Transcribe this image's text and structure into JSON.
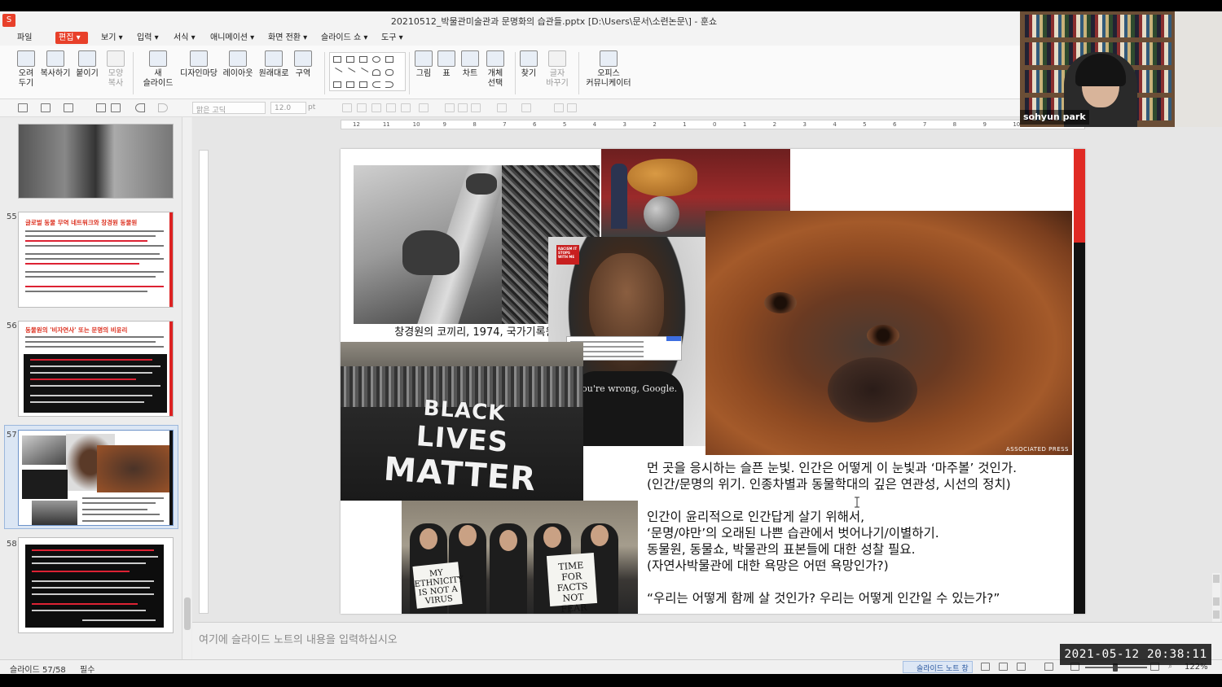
{
  "window": {
    "title": "20210512_박물관미술관과 문명화의 습관들.pptx [D:\\Users\\문서\\소련논문\\] - 훈쇼",
    "app_icon": "hanshow-app-icon"
  },
  "menu": {
    "items": [
      "파일",
      "편집",
      "보기",
      "입력",
      "서식",
      "애니메이션",
      "화면 전환",
      "슬라이드 쇼",
      "도구"
    ],
    "active_index": 1
  },
  "ribbon": {
    "buttons": [
      {
        "label": "오려\n두기",
        "icon": "scissors-icon"
      },
      {
        "label": "복사하기",
        "icon": "copy-icon"
      },
      {
        "label": "붙이기",
        "icon": "paste-icon"
      },
      {
        "label": "모양\n복사",
        "icon": "format-painter-icon",
        "disabled": true
      },
      {
        "label": "새\n슬라이드",
        "icon": "new-slide-icon"
      },
      {
        "label": "디자인마당",
        "icon": "design-icon"
      },
      {
        "label": "레이아웃",
        "icon": "layout-icon"
      },
      {
        "label": "원래대로",
        "icon": "reset-icon"
      },
      {
        "label": "구역",
        "icon": "section-icon"
      },
      {
        "label": "그림",
        "icon": "picture-icon"
      },
      {
        "label": "표",
        "icon": "table-icon"
      },
      {
        "label": "차트",
        "icon": "chart-icon"
      },
      {
        "label": "개체\n선택",
        "icon": "select-object-icon"
      },
      {
        "label": "찾기",
        "icon": "find-icon"
      },
      {
        "label": "글자\n바꾸기",
        "icon": "replace-icon",
        "disabled": true
      },
      {
        "label": "오피스\n커뮤니케이터",
        "icon": "office-communicator-icon"
      }
    ]
  },
  "format_toolbar": {
    "font_name": "맑은 고딕",
    "font_size": "12.0",
    "font_unit": "pt"
  },
  "ruler": {
    "h_ticks": [
      "12",
      "11",
      "10",
      "9",
      "8",
      "7",
      "6",
      "5",
      "4",
      "3",
      "2",
      "1",
      "0",
      "1",
      "2",
      "3",
      "4",
      "5",
      "6",
      "7",
      "8",
      "9",
      "10",
      "11",
      "12"
    ]
  },
  "thumbnails": [
    {
      "number": "",
      "title": ""
    },
    {
      "number": "55",
      "title": "글로벌 동물 무역 네트워크와 창경원 동물원"
    },
    {
      "number": "56",
      "title": "동물원의 '비자연사' 또는 문명의 비윤리"
    },
    {
      "number": "57",
      "title": ""
    },
    {
      "number": "58",
      "title": ""
    }
  ],
  "slide": {
    "elephant_caption": "창경원의 코끼리, 1974, 국가기록원.",
    "ad_logo": "RACISM IT STOPS WITH ME",
    "ad_slogan": "You're wrong, Google.",
    "ap_credit": "ASSOCIATED PRESS",
    "blm_lines": [
      "BLACK",
      "LIVES",
      "MATTER"
    ],
    "sign_left": "MY ETHNICITY IS NOT A VIRUS",
    "sign_right": "TIME FOR FACTS NOT FEAR",
    "text_lines": [
      "먼 곳을 응시하는 슬픈 눈빛. 인간은 어떻게 이 눈빛과 ‘마주볼’ 것인가.",
      "(인간/문명의 위기. 인종차별과 동물학대의 깊은 연관성, 시선의 정치)",
      "",
      "인간이 윤리적으로 인간답게 살기 위해서,",
      "‘문명/야만’의 오래된 나쁜 습관에서 벗어나기/이별하기.",
      "동물원, 동물쇼, 박물관의 표본들에 대한 성찰 필요.",
      "(자연사박물관에 대한 욕망은 어떤 욕망인가?)",
      "",
      "“우리는 어떻게 함께 살 것인가? 우리는 어떻게 인간일 수 있는가?”"
    ]
  },
  "notes": {
    "placeholder": "여기에 슬라이드 노트의 내용을 입력하십시오"
  },
  "status": {
    "slide_position": "슬라이드 57/58",
    "language": "필수",
    "notes_button": "슬라이드 노트 창",
    "zoom": "122%"
  },
  "overlay": {
    "timestamp": "2021-05-12  20:38:11",
    "participant_name": "sohyun park"
  },
  "colors": {
    "accent": "#e8402a",
    "slide_red_bar": "#e02a24"
  }
}
